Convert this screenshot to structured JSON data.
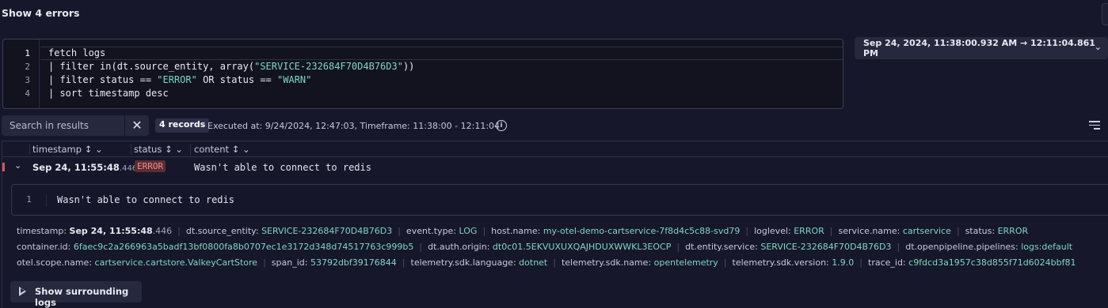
{
  "header": {
    "title": "Show 4 errors"
  },
  "editor": {
    "line_numbers": [
      "1",
      "2",
      "3",
      "4"
    ],
    "lines": [
      {
        "parts": [
          {
            "text": "fetch logs",
            "cls": "kw"
          }
        ]
      },
      {
        "parts": [
          {
            "text": "| filter in(dt.source_entity, array(",
            "cls": "kw"
          },
          {
            "text": "\"SERVICE-232684F70D4B76D3\"",
            "cls": "str"
          },
          {
            "text": "))",
            "cls": "kw"
          }
        ]
      },
      {
        "parts": [
          {
            "text": "| filter status == ",
            "cls": "kw"
          },
          {
            "text": "\"ERROR\"",
            "cls": "str"
          },
          {
            "text": " OR status == ",
            "cls": "kw"
          },
          {
            "text": "\"WARN\"",
            "cls": "str"
          }
        ]
      },
      {
        "parts": [
          {
            "text": "| sort timestamp desc",
            "cls": "kw"
          }
        ]
      }
    ]
  },
  "timeframe": {
    "label": "Sep 24, 2024, 11:38:00.932 AM  →  12:11:04.861 PM",
    "chevron": "⌄"
  },
  "results": {
    "search_placeholder": "Search in results",
    "clear_symbol": "✕",
    "records": "4 records",
    "executed": "Executed at: 9/24/2024, 12:47:03, Timeframe: 11:38:00 - 12:11:04",
    "info": "i"
  },
  "table": {
    "columns": [
      {
        "label": "timestamp ↕ ⌄"
      },
      {
        "label": "status ↕ ⌄"
      },
      {
        "label": "content ↕ ⌄"
      }
    ],
    "row": {
      "chevron": "⌄",
      "timestamp": "Sep 24, 11:55:48",
      "timestamp_ms": ".446",
      "status": "ERROR",
      "content": "Wasn't able to connect to redis"
    }
  },
  "detail": {
    "line_number": "1",
    "text": "Wasn't able to connect to redis",
    "attributes": [
      [
        {
          "key": "timestamp:",
          "value": "Sep 24, 11:55:48",
          "ms": ".446",
          "plain": true
        },
        {
          "key": "dt.source_entity:",
          "value": "SERVICE-232684F70D4B76D3"
        },
        {
          "key": "event.type:",
          "value": "LOG"
        },
        {
          "key": "host.name:",
          "value": "my-otel-demo-cartservice-7f8d4c5c88-svd79"
        },
        {
          "key": "loglevel:",
          "value": "ERROR"
        },
        {
          "key": "service.name:",
          "value": "cartservice"
        },
        {
          "key": "status:",
          "value": "ERROR"
        }
      ],
      [
        {
          "key": "container.id:",
          "value": "6faec9c2a266963a5badf13bf0800fa8b0707ec1e3172d348d74517763c999b5"
        },
        {
          "key": "dt.auth.origin:",
          "value": "dt0c01.5EKVUXUXQAJHDUXWWKL3EOCP"
        },
        {
          "key": "dt.entity.service:",
          "value": "SERVICE-232684F70D4B76D3"
        },
        {
          "key": "dt.openpipeline.pipelines:",
          "value": "logs:default"
        }
      ],
      [
        {
          "key": "otel.scope.name:",
          "value": "cartservice.cartstore.ValkeyCartStore"
        },
        {
          "key": "span_id:",
          "value": "53792dbf39176844"
        },
        {
          "key": "telemetry.sdk.language:",
          "value": "dotnet"
        },
        {
          "key": "telemetry.sdk.name:",
          "value": "opentelemetry"
        },
        {
          "key": "telemetry.sdk.version:",
          "value": "1.9.0"
        },
        {
          "key": "trace_id:",
          "value": "c9fdcd3a1957c38d855f71d6024bbf81"
        }
      ]
    ],
    "surround_button": "Show surrounding logs"
  }
}
